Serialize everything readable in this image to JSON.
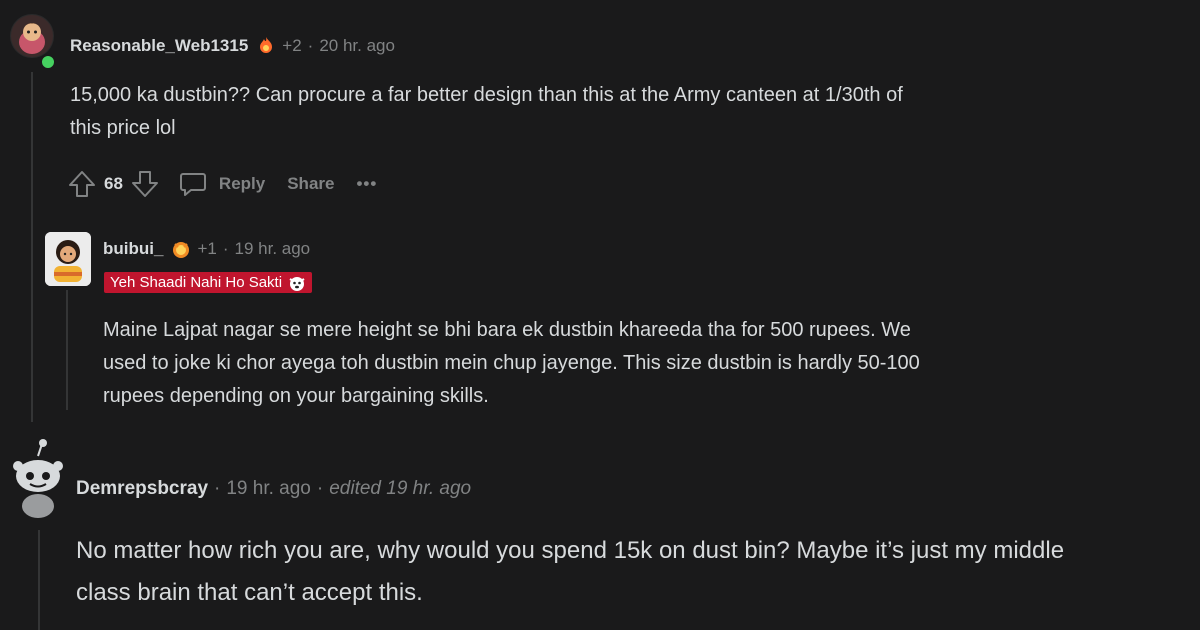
{
  "comments": [
    {
      "username": "Reasonable_Web1315",
      "award_count": "+2",
      "time": "20 hr. ago",
      "body_lines": [
        "15,000 ka dustbin?? Can procure a far better design than this at the Army canteen at 1/30th of",
        "this price lol"
      ],
      "votes": "68",
      "reply_label": "Reply",
      "share_label": "Share",
      "more_label": "•••"
    },
    {
      "username": "buibui_",
      "award_count": "+1",
      "time": "19 hr. ago",
      "flair": "Yeh Shaadi Nahi Ho Sakti",
      "body_lines": [
        "Maine Lajpat nagar se mere height se bhi bara ek dustbin khareeda tha for 500 rupees. We",
        "used to joke ki chor ayega toh dustbin mein chup jayenge. This size dustbin is hardly 50-100",
        "rupees depending on your bargaining skills."
      ]
    },
    {
      "username": "Demrepsbcray",
      "time": "19 hr. ago",
      "edited": "edited 19 hr. ago",
      "body_lines": [
        "No matter how rich you are, why would you spend 15k on dust bin? Maybe it’s just my middle",
        "class brain that can’t accept this."
      ]
    }
  ],
  "colors": {
    "background": "#1a1a1b",
    "text": "#d7dadc",
    "muted": "#818384",
    "flair_bg": "#c0152e",
    "online": "#46d160"
  },
  "icons": [
    "upvote-icon",
    "downvote-icon",
    "comment-bubble-icon",
    "award-icon",
    "snoo-avatar-icon"
  ]
}
